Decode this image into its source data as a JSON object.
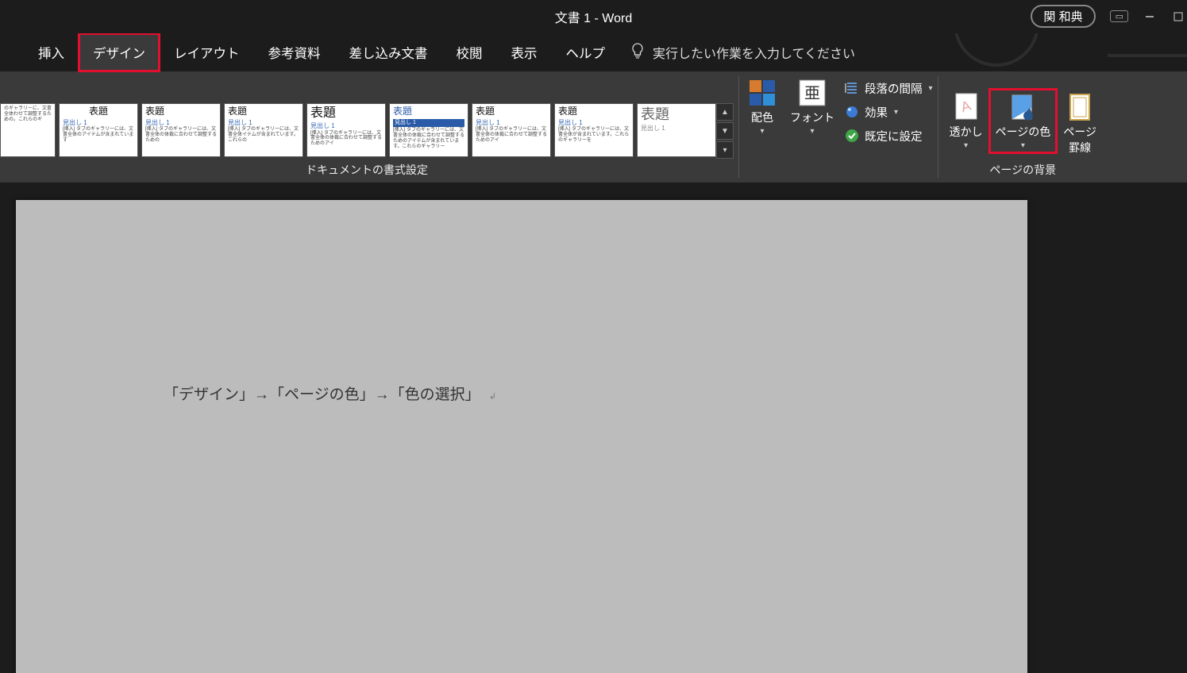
{
  "title": "文書 1  -  Word",
  "user": "関 和典",
  "search_placeholder": "実行したい作業を入力してください",
  "tabs": [
    {
      "label": "挿入",
      "active": false
    },
    {
      "label": "デザイン",
      "active": true,
      "highlight": true
    },
    {
      "label": "レイアウト",
      "active": false
    },
    {
      "label": "参考資料",
      "active": false
    },
    {
      "label": "差し込み文書",
      "active": false
    },
    {
      "label": "校閲",
      "active": false
    },
    {
      "label": "表示",
      "active": false
    },
    {
      "label": "ヘルプ",
      "active": false
    }
  ],
  "ribbon": {
    "doc_format_group_label": "ドキュメントの書式設定",
    "page_bg_group_label": "ページの背景",
    "themes": [
      {
        "title": "",
        "heading": "",
        "body": "のギャラリーに、文書全体わせて調整するための。これらのギ",
        "variant": "first"
      },
      {
        "title": "表題",
        "heading": "見出し 1",
        "body": "[挿入] タブのギャラリーには、文書全体のアイテムが含まれています",
        "variant": "centered"
      },
      {
        "title": "表題",
        "heading": "見出し 1",
        "body": "[挿入] タブのギャラリーには、文書全体の体裁に合わせて調整するための",
        "variant": "plain"
      },
      {
        "title": "表題",
        "heading": "見出し 1",
        "body": "[挿入] タブのギャラリーには、文書全体イテムが含まれています。これらの",
        "variant": "plain"
      },
      {
        "title": "表題",
        "heading": "見出し 1",
        "body": "[挿入] タブのギャラリーには、文書全体の体裁に合わせて調整するためのアイ",
        "variant": "plain"
      },
      {
        "title": "表題",
        "heading": "見出し 1",
        "body": "[挿入] タブのギャラリーには、文書全体の体裁に合わせて調整するためのアイテムが含まれています。これらのギャラリー",
        "variant": "band"
      },
      {
        "title": "表題",
        "heading": "見出し 1",
        "body": "[挿入] タブのギャラリーには、文書全体の体裁に合わせて調整するためのアイ",
        "variant": "plain"
      },
      {
        "title": "表題",
        "heading": "見出し 1",
        "body": "[挿入] タブのギャラリーには、文書全体が含まれています。これらのギャラリーを",
        "variant": "plain"
      },
      {
        "title": "表題",
        "heading": "見出し 1",
        "body": "",
        "variant": "grey"
      }
    ],
    "colors_label": "配色",
    "fonts_label": "フォント",
    "spacing_label": "段落の間隔",
    "effects_label": "効果",
    "set_default_label": "既定に設定",
    "watermark_label": "透かし",
    "page_color_label": "ページの色",
    "page_borders_label": "ページ罫線"
  },
  "document": {
    "text": "「デザイン」→「ページの色」→「色の選択」"
  },
  "highlight_page_color": true,
  "colors": {
    "highlight": "#e20f2f"
  }
}
